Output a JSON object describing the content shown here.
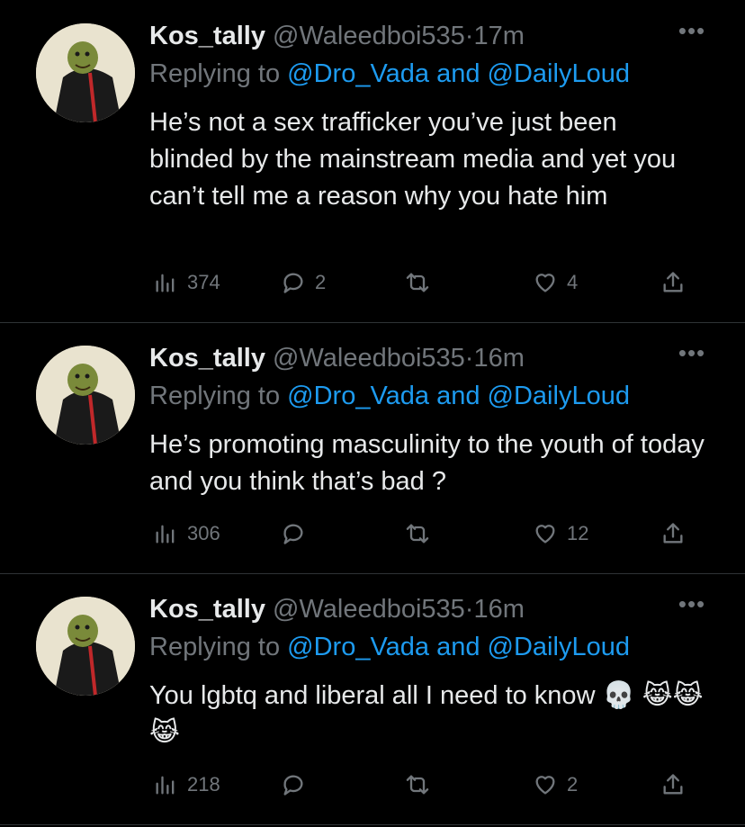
{
  "colors": {
    "background": "#000000",
    "text": "#e7e9ea",
    "muted": "#71767b",
    "link": "#1d9bf0",
    "divider": "#2f3336"
  },
  "icons": {
    "more": "more-dots-icon",
    "views": "analytics-bars-icon",
    "reply": "reply-bubble-icon",
    "retweet": "retweet-icon",
    "like": "heart-icon",
    "share": "share-upload-icon"
  },
  "tweets": [
    {
      "name": "Kos_tally",
      "handle": "@Waleedboi535",
      "separator": "·",
      "time": "17m",
      "reply_prefix": "Replying to",
      "reply_user1": "@Dro_Vada",
      "reply_and": "and",
      "reply_user2": "@DailyLoud",
      "body": "He’s not a sex trafficker you’ve just been blinded by the mainstream media and yet you can’t tell me a reason why you hate him",
      "views": "374",
      "replies": "2",
      "retweets": "",
      "likes": "4"
    },
    {
      "name": "Kos_tally",
      "handle": "@Waleedboi535",
      "separator": "·",
      "time": "16m",
      "reply_prefix": "Replying to",
      "reply_user1": "@Dro_Vada",
      "reply_and": "and",
      "reply_user2": "@DailyLoud",
      "body": "He’s promoting masculinity to the youth of today and you think that’s bad ?",
      "views": "306",
      "replies": "",
      "retweets": "",
      "likes": "12"
    },
    {
      "name": "Kos_tally",
      "handle": "@Waleedboi535",
      "separator": "·",
      "time": "16m",
      "reply_prefix": "Replying to",
      "reply_user1": "@Dro_Vada",
      "reply_and": "and",
      "reply_user2": "@DailyLoud",
      "body": "You lgbtq and liberal all I need to know 💀 😹😹😹",
      "views": "218",
      "replies": "",
      "retweets": "",
      "likes": "2"
    }
  ]
}
